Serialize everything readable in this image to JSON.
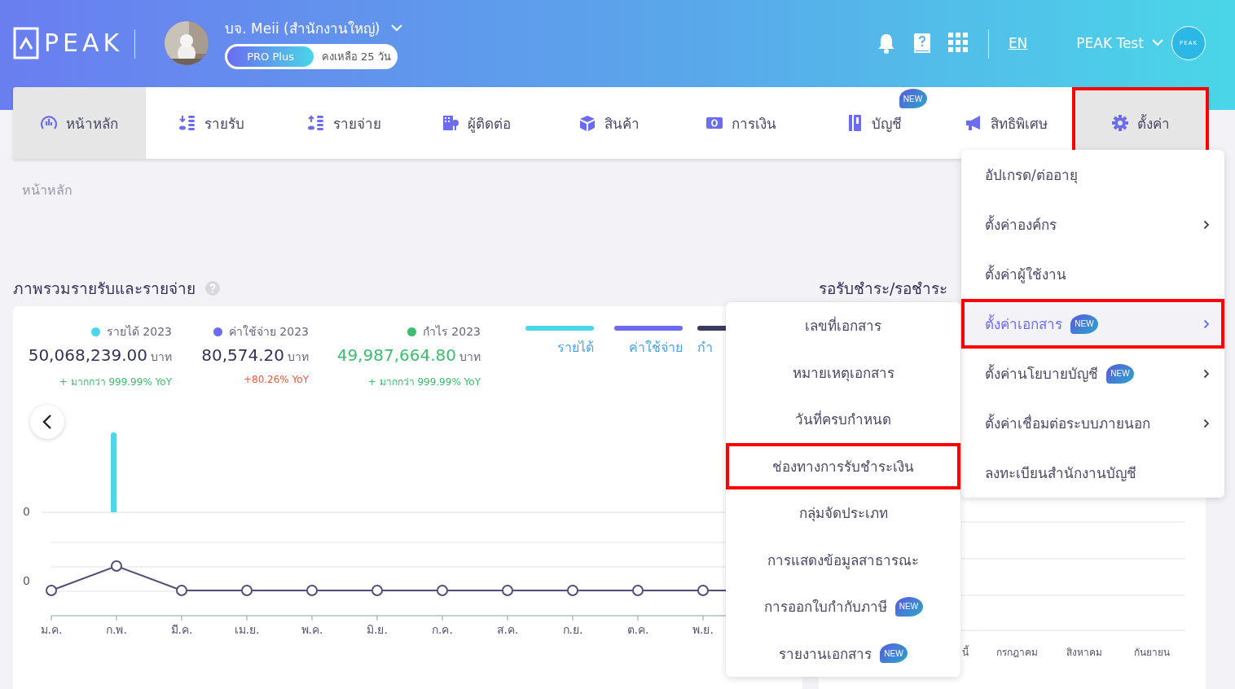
{
  "header": {
    "logo": "PEAK",
    "company": "บจ. Meii (สำนักงานใหญ่)",
    "plan": "PRO Plus",
    "remaining": "คงเหลือ 25 วัน",
    "language": "EN",
    "user": "PEAK Test",
    "user_avatar": "PEAK"
  },
  "nav": [
    {
      "label": "หน้าหลัก",
      "selected": true,
      "highlighted": false
    },
    {
      "label": "รายรับ",
      "selected": false,
      "highlighted": false
    },
    {
      "label": "รายจ่าย",
      "selected": false,
      "highlighted": false
    },
    {
      "label": "ผู้ติดต่อ",
      "selected": false,
      "highlighted": false
    },
    {
      "label": "สินค้า",
      "selected": false,
      "highlighted": false
    },
    {
      "label": "การเงิน",
      "selected": false,
      "highlighted": false
    },
    {
      "label": "บัญชี",
      "selected": false,
      "highlighted": false,
      "badge": "NEW"
    },
    {
      "label": "สิทธิพิเศษ",
      "selected": false,
      "highlighted": false
    },
    {
      "label": "ตั้งค่า",
      "selected": true,
      "highlighted": true
    }
  ],
  "breadcrumb": "หน้าหลัก",
  "overview": {
    "title": "ภาพรวมรายรับและรายจ่าย",
    "stats": [
      {
        "label": "รายได้ 2023",
        "color": "#4dd6e8",
        "value": "50,068,239.00",
        "unit": "บาท",
        "change": "+ มากกว่า 999.99% YoY",
        "negative": false,
        "emphasized": false
      },
      {
        "label": "ค่าใช้จ่าย 2023",
        "color": "#6c6cf0",
        "value": "80,574.20",
        "unit": "บาท",
        "change": "+80.26% YoY",
        "negative": true,
        "emphasized": false
      },
      {
        "label": "กำไร 2023",
        "color": "#3dbd6e",
        "value": "49,987,664.80",
        "unit": "บาท",
        "change": "+ มากกว่า 999.99% YoY",
        "negative": false,
        "emphasized": true
      }
    ],
    "legend": [
      {
        "label": "รายได้",
        "color": "#4dd6e8"
      },
      {
        "label": "ค่าใช้จ่าย",
        "color": "#6c6cf0"
      },
      {
        "label": "กำ",
        "color": "#3a3a5c"
      }
    ],
    "y_labels": [
      "0",
      "0"
    ],
    "months": [
      "ม.ค.",
      "ก.พ.",
      "มี.ค.",
      "เม.ย.",
      "พ.ค.",
      "มิ.ย.",
      "ก.ค.",
      "ส.ค.",
      "ก.ย.",
      "ต.ค.",
      "พ.ย."
    ]
  },
  "receivables": {
    "title": "รอรับชำระ/รอชำระ",
    "months": [
      "นี้",
      "กรกฎาคม",
      "สิงหาคม",
      "กันยายน"
    ]
  },
  "settings_menu": [
    {
      "label": "อัปเกรด/ต่ออายุ",
      "has_submenu": false,
      "selected": false,
      "highlighted": false
    },
    {
      "label": "ตั้งค่าองค์กร",
      "has_submenu": true,
      "selected": false,
      "highlighted": false
    },
    {
      "label": "ตั้งค่าผู้ใช้งาน",
      "has_submenu": false,
      "selected": false,
      "highlighted": false
    },
    {
      "label": "ตั้งค่าเอกสาร",
      "has_submenu": true,
      "selected": true,
      "highlighted": true,
      "badge": "NEW"
    },
    {
      "label": "ตั้งค่านโยบายบัญชี",
      "has_submenu": true,
      "selected": false,
      "highlighted": false,
      "badge": "NEW"
    },
    {
      "label": "ตั้งค่าเชื่อมต่อระบบภายนอก",
      "has_submenu": true,
      "selected": false,
      "highlighted": false
    },
    {
      "label": "ลงทะเบียนสำนักงานบัญชี",
      "has_submenu": false,
      "selected": false,
      "highlighted": false
    }
  ],
  "document_submenu": [
    {
      "label": "เลขที่เอกสาร",
      "highlighted": false
    },
    {
      "label": "หมายเหตุเอกสาร",
      "highlighted": false
    },
    {
      "label": "วันที่ครบกำหนด",
      "highlighted": false
    },
    {
      "label": "ช่องทางการรับชำระเงิน",
      "highlighted": true
    },
    {
      "label": "กลุ่มจัดประเภท",
      "highlighted": false
    },
    {
      "label": "การแสดงข้อมูลสาธารณะ",
      "highlighted": false
    },
    {
      "label": "การออกใบกำกับภาษี",
      "highlighted": false,
      "badge": "NEW"
    },
    {
      "label": "รายงานเอกสาร",
      "highlighted": false,
      "badge": "NEW"
    }
  ]
}
